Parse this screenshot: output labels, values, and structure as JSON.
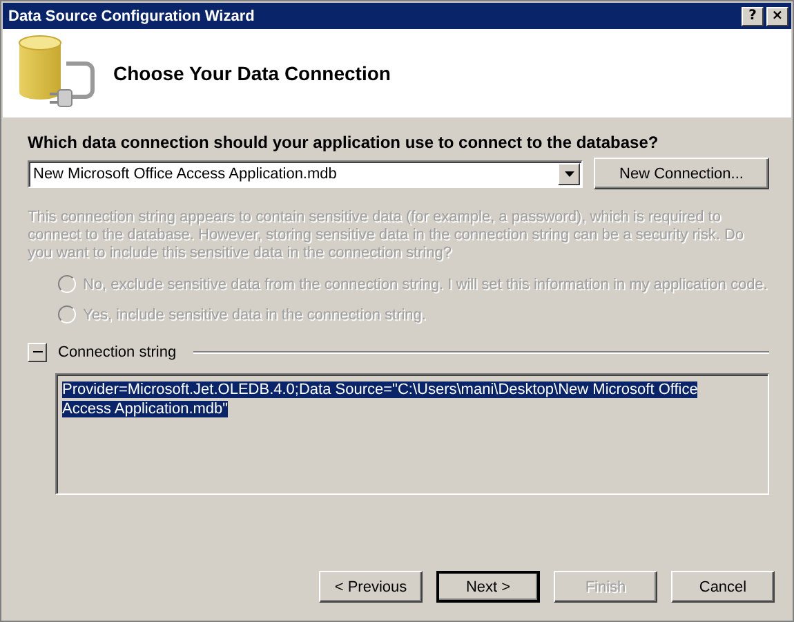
{
  "window": {
    "title": "Data Source Configuration Wizard",
    "title_buttons": [
      "?",
      "×"
    ]
  },
  "header": {
    "title": "Choose Your Data Connection"
  },
  "connection": {
    "question": "Which data connection should your application use to connect to the database?",
    "value": "New Microsoft Office Access Application.mdb",
    "new_button": "New Connection..."
  },
  "sensitive": {
    "text": "This connection string appears to contain sensitive data (for example, a password), which is required to connect to the database. However, storing sensitive data in the connection string can be a security risk. Do you want to include this sensitive data in the connection string?",
    "disabled": true,
    "options": [
      {
        "label": "No, exclude sensitive data from the connection string. I will set this information in my application code.",
        "selected": false
      },
      {
        "label": "Yes, include sensitive data in the connection string.",
        "selected": false
      }
    ]
  },
  "connection_string": {
    "label": "Connection string",
    "expanded": true,
    "value": "Provider=Microsoft.Jet.OLEDB.4.0;Data Source=\"C:\\Users\\mani\\Desktop\\New Microsoft Office Access Application.mdb\"",
    "text_selected": true
  },
  "buttons": [
    {
      "label": "< Previous",
      "default": false,
      "disabled": false
    },
    {
      "label": "Next >",
      "default": true,
      "disabled": false
    },
    {
      "label": "Finish",
      "default": false,
      "disabled": true
    },
    {
      "label": "Cancel",
      "default": false,
      "disabled": false
    }
  ]
}
